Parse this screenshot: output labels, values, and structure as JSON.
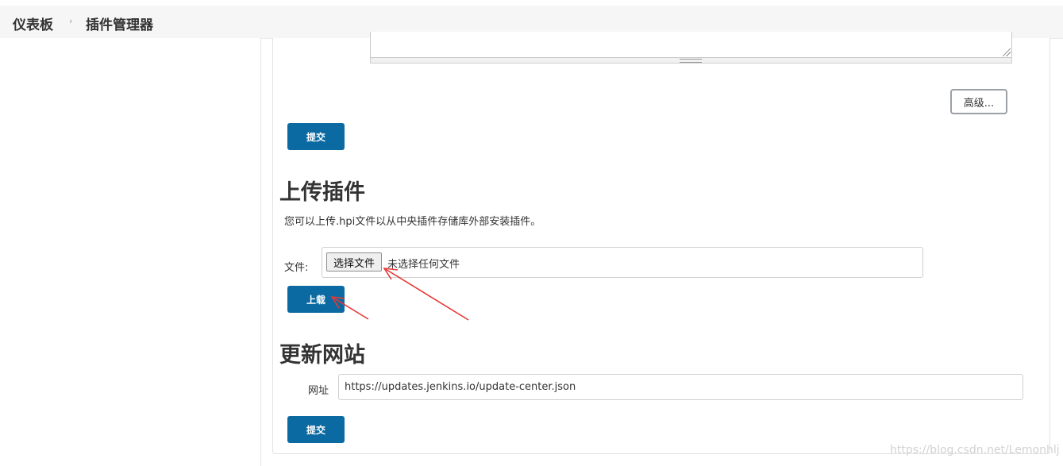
{
  "breadcrumb": {
    "items": [
      "仪表板",
      "插件管理器"
    ],
    "separator": "›"
  },
  "advanced_section": {
    "advanced_label": "高级...",
    "submit_label": "提交"
  },
  "upload_plugin": {
    "title": "上传插件",
    "description": "您可以上传.hpi文件以从中央插件存储库外部安装插件。",
    "file_label": "文件:",
    "choose_file_label": "选择文件",
    "no_file_text": "未选择任何文件",
    "upload_label": "上载"
  },
  "update_site": {
    "title": "更新网站",
    "url_label": "网址",
    "url_value": "https://updates.jenkins.io/update-center.json",
    "submit_label": "提交"
  },
  "watermark": "https://blog.csdn.net/Lemonhlj",
  "colors": {
    "primary_button": "#0b6aa2",
    "annotation_arrow": "#e53935"
  }
}
